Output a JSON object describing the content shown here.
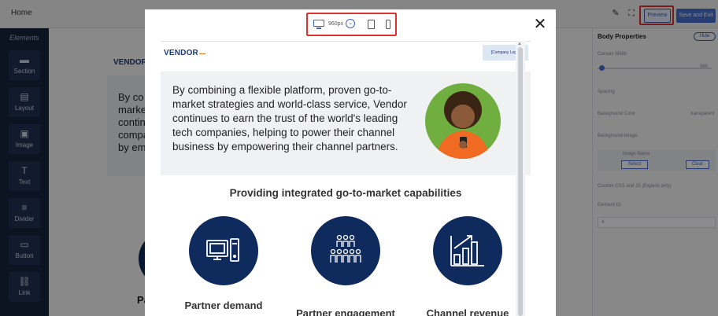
{
  "topbar": {
    "home": "Home",
    "preview_label": "Preview",
    "save_label": "Save and Exit"
  },
  "sidebar": {
    "heading": "Elements",
    "items": [
      {
        "label": "Section",
        "icon": "section-icon",
        "glyph": "▬"
      },
      {
        "label": "Layout",
        "icon": "layout-icon",
        "glyph": "▤"
      },
      {
        "label": "Image",
        "icon": "image-icon",
        "glyph": "▣"
      },
      {
        "label": "Text",
        "icon": "text-icon",
        "glyph": "T"
      },
      {
        "label": "Divider",
        "icon": "divider-icon",
        "glyph": "≡"
      },
      {
        "label": "Button",
        "icon": "button-icon",
        "glyph": "▭"
      },
      {
        "label": "Link",
        "icon": "link-icon",
        "glyph": "⛓"
      }
    ]
  },
  "canvas": {
    "vendor": "VENDOR",
    "text_fragment": "By co\nmarke\ncontin\ncompa\nby em",
    "partial_label": "Pa"
  },
  "panel": {
    "title": "Body Properties",
    "hide_label": "Hide",
    "canvas_width_label": "Canvas Width",
    "canvas_width_value": "960",
    "spacing_label": "Spacing",
    "bg_color_label": "Background Color",
    "bg_color_value": "transparent",
    "bg_image_label": "Background Image",
    "image_name_label": "Image Name",
    "select_label": "Select",
    "clear_label": "Clear",
    "custom_css_label": "Custom CSS and JS (Experts only)",
    "element_id_label": "Element ID",
    "element_id_value": "4"
  },
  "modal": {
    "device": {
      "width_label": "960px"
    },
    "close_glyph": "✕",
    "preview": {
      "logo": "VENDOR",
      "company_logo": "[Company Logo]",
      "hero_text": "By combining a flexible platform, proven go-to-market strategies and world-class service, Vendor continues to earn the trust of the world's leading tech companies, helping to power their channel business by empowering their channel partners.",
      "capabilities_title": "Providing integrated go-to-market capabilities",
      "features": [
        {
          "label": "Partner demand generation",
          "icon": "computer-icon"
        },
        {
          "label": "Partner engagement",
          "icon": "people-icon"
        },
        {
          "label": "Channel revenue",
          "icon": "bar-chart-icon"
        }
      ]
    }
  },
  "colors": {
    "navy": "#0f2a5c",
    "accent_blue": "#3a66c9",
    "highlight_red": "#e0312f"
  }
}
